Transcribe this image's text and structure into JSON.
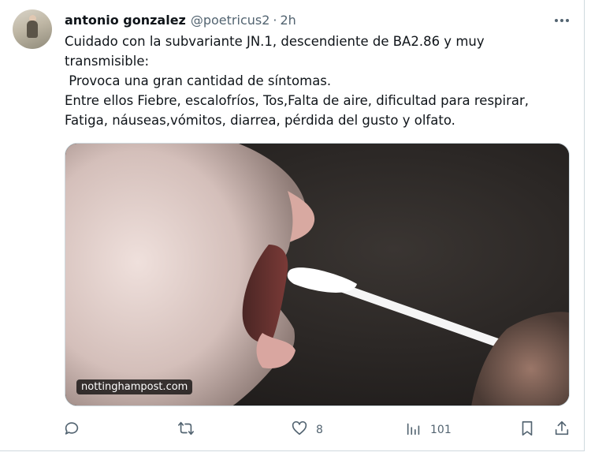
{
  "tweet": {
    "author_name": "antonio gonzalez",
    "author_handle": "@poetricus2",
    "separator": "·",
    "time": "2h",
    "text_lines": [
      "Cuidado con la subvariante JN.1, descendiente de BA2.86 y muy",
      "transmisible:",
      " Provoca una gran cantidad de síntomas.",
      "Entre ellos Fiebre, escalofríos, Tos,Falta de aire, dificultad para respirar,",
      "Fatiga, náuseas,vómitos, diarrea, pérdida del gusto y olfato."
    ],
    "media_source": "nottinghampost.com"
  },
  "actions": {
    "reply_icon": "reply-icon",
    "retweet_icon": "retweet-icon",
    "like_icon": "heart-icon",
    "like_count": "8",
    "views_icon": "analytics-icon",
    "view_count": "101",
    "bookmark_icon": "bookmark-icon",
    "share_icon": "share-icon"
  },
  "colors": {
    "text_primary": "#0f1419",
    "text_secondary": "#536471",
    "border": "#cfd9de"
  }
}
